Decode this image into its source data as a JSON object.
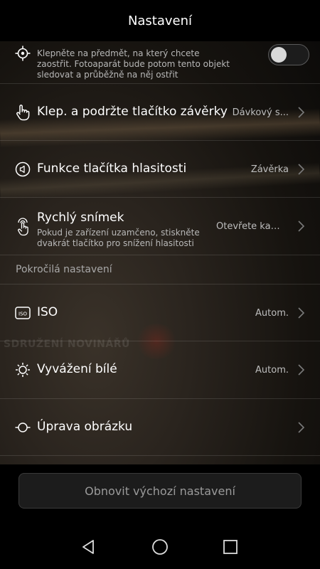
{
  "header": {
    "title": "Nastavení"
  },
  "rows": {
    "focus": {
      "sub": "Klepněte na předmět, na který chcete zaostřit. Fotoaparát bude potom tento objekt sledovat a průběžně na něj ostřit",
      "toggle_on": false
    },
    "shutter": {
      "label": "Klep. a podržte tlačítko závěrky",
      "value": "Dávkový s..."
    },
    "volume": {
      "label": "Funkce tlačítka hlasitosti",
      "value": "Závěrka"
    },
    "quick": {
      "label": "Rychlý snímek",
      "sub": "Pokud je zařízení uzamčeno, stiskněte dvakrát tlačítko pro snížení hlasitosti",
      "value": "Otevřete kamer..."
    },
    "advanced_section": "Pokročilá nastavení",
    "iso": {
      "icon_text": "ISO",
      "label": "ISO",
      "value": "Autom."
    },
    "wb": {
      "label": "Vyvážení bílé",
      "value": "Autom."
    },
    "adjust": {
      "label": "Úprava obrázku"
    }
  },
  "background": {
    "watermark": "SDRUŽENÍ NOVINÁŘŮ"
  },
  "footer": {
    "reset_label": "Obnovit výchozí nastavení"
  },
  "icons": [
    "focus-target-icon",
    "hand-tap-icon",
    "speaker-icon",
    "quick-snapshot-icon",
    "iso-icon",
    "white-balance-icon",
    "image-adjust-icon",
    "chevron-right-icon",
    "back-icon",
    "home-icon",
    "recents-icon"
  ]
}
